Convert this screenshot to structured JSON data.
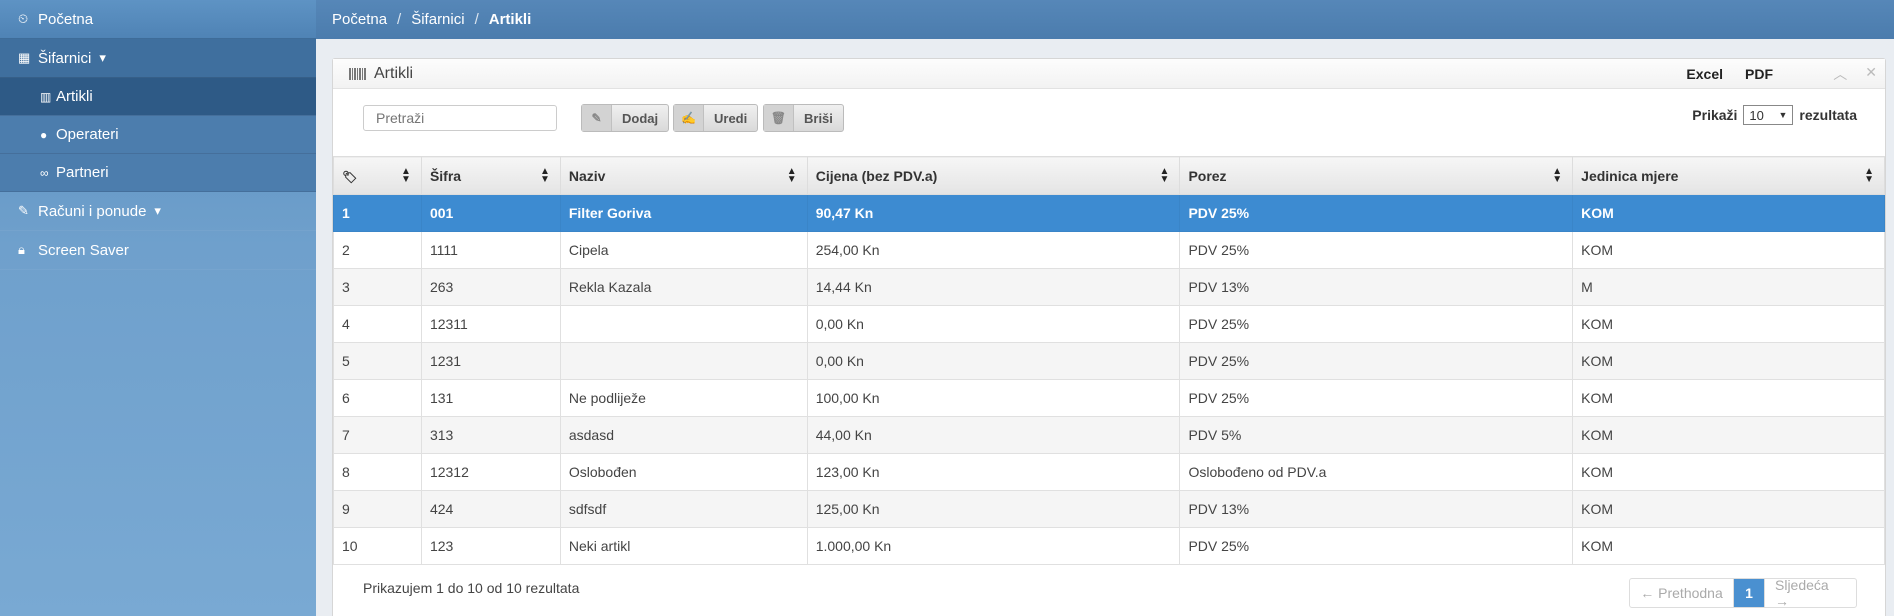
{
  "sidebar": {
    "home": {
      "label": "Početna",
      "icon": "dashboard-icon"
    },
    "sifarnici": {
      "label": "Šifarnici",
      "icon": "table-icon"
    },
    "sub": [
      {
        "label": "Artikli",
        "icon": "barcode-icon"
      },
      {
        "label": "Operateri",
        "icon": "user-icon"
      },
      {
        "label": "Partneri",
        "icon": "link-icon"
      }
    ],
    "racuni": {
      "label": "Računi i ponude",
      "icon": "edit-icon"
    },
    "screensaver": {
      "label": "Screen Saver",
      "icon": "lock-icon"
    }
  },
  "breadcrumb": {
    "home": "Početna",
    "section": "Šifarnici",
    "current": "Artikli",
    "separator": "/"
  },
  "panel": {
    "title": "Artikli",
    "excel": "Excel",
    "pdf": "PDF"
  },
  "toolbar": {
    "search_placeholder": "Pretraži",
    "add": "Dodaj",
    "edit": "Uredi",
    "delete": "Briši",
    "show_label": "Prikaži",
    "show_value": "10",
    "show_suffix": "rezultata"
  },
  "table": {
    "columns": [
      "",
      "Šifra",
      "Naziv",
      "Cijena (bez PDV.a)",
      "Porez",
      "Jedinica mjere"
    ],
    "rows": [
      [
        "1",
        "001",
        "Filter Goriva",
        "90,47 Kn",
        "PDV 25%",
        "KOM"
      ],
      [
        "2",
        "1111",
        "Cipela",
        "254,00 Kn",
        "PDV 25%",
        "KOM"
      ],
      [
        "3",
        "263",
        "Rekla Kazala",
        "14,44 Kn",
        "PDV 13%",
        "M"
      ],
      [
        "4",
        "12311",
        "",
        "0,00 Kn",
        "PDV 25%",
        "KOM"
      ],
      [
        "5",
        "1231",
        "",
        "0,00 Kn",
        "PDV 25%",
        "KOM"
      ],
      [
        "6",
        "131",
        "Ne podliježe",
        "100,00 Kn",
        "PDV 25%",
        "KOM"
      ],
      [
        "7",
        "313",
        "asdasd",
        "44,00 Kn",
        "PDV 5%",
        "KOM"
      ],
      [
        "8",
        "12312",
        "Oslobođen",
        "123,00 Kn",
        "Oslobođeno od PDV.a",
        "KOM"
      ],
      [
        "9",
        "424",
        "sdfsdf",
        "125,00 Kn",
        "PDV 13%",
        "KOM"
      ],
      [
        "10",
        "123",
        "Neki artikl",
        "1.000,00 Kn",
        "PDV 25%",
        "KOM"
      ]
    ],
    "selected_row": 0
  },
  "footer": {
    "info": "Prikazujem 1 do 10 od 10 rezultata",
    "prev": "← Prethodna",
    "page": "1",
    "next": "Sljedeća →"
  },
  "colors": {
    "accent": "#3d8bd1",
    "sidebar": "#6fa0cc"
  }
}
